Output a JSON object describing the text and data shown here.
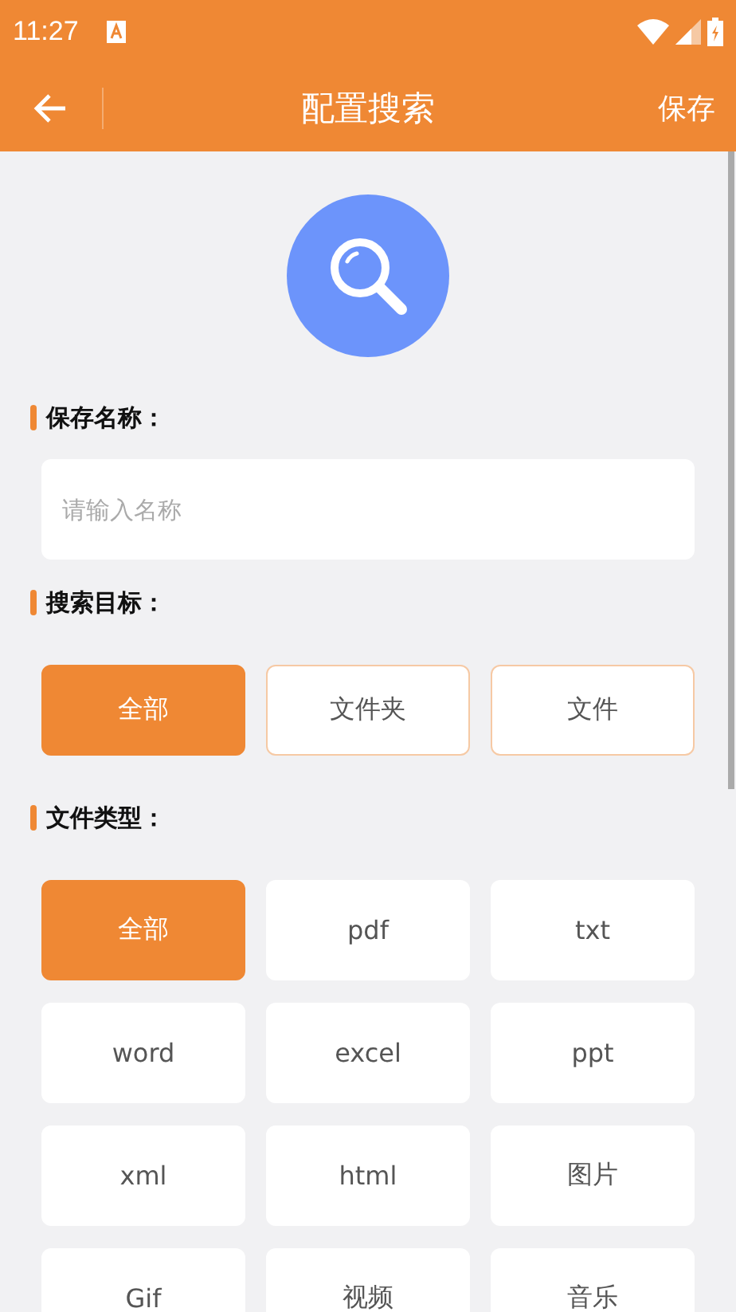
{
  "status_bar": {
    "time": "11:27"
  },
  "app_bar": {
    "title": "配置搜索",
    "action": "保存"
  },
  "sections": [
    {
      "kind": "input",
      "label": "保存名称：",
      "placeholder": "请输入名称"
    },
    {
      "kind": "options",
      "label": "搜索目标：",
      "options": [
        {
          "label": "全部",
          "selected": true
        },
        {
          "label": "文件夹",
          "selected": false
        },
        {
          "label": "文件",
          "selected": false
        }
      ]
    },
    {
      "kind": "grid",
      "label": "文件类型：",
      "options": [
        {
          "label": "全部",
          "selected": true
        },
        {
          "label": "pdf",
          "selected": false
        },
        {
          "label": "txt",
          "selected": false
        },
        {
          "label": "word",
          "selected": false
        },
        {
          "label": "excel",
          "selected": false
        },
        {
          "label": "ppt",
          "selected": false
        },
        {
          "label": "xml",
          "selected": false
        },
        {
          "label": "html",
          "selected": false
        },
        {
          "label": "图片",
          "selected": false
        },
        {
          "label": "Gif",
          "selected": false
        },
        {
          "label": "视频",
          "selected": false
        },
        {
          "label": "音乐",
          "selected": false
        }
      ]
    }
  ]
}
